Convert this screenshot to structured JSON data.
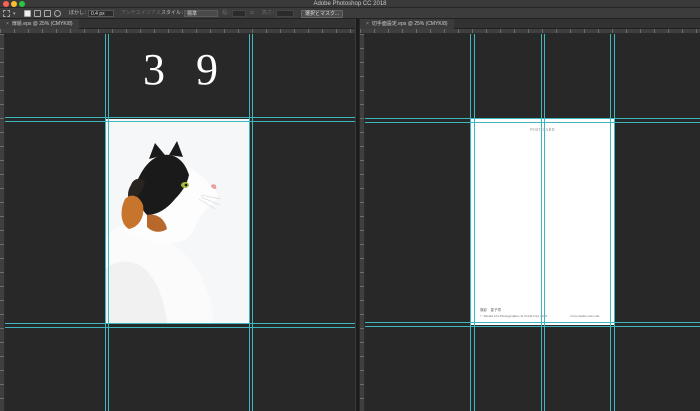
{
  "app": {
    "title": "Adobe Photoshop CC 2018"
  },
  "options_bar": {
    "feather_label": "ぼかし：",
    "feather_value": "0.4 px",
    "antialias_label": "アンチエイリアス",
    "style_label": "スタイル：",
    "style_value": "標準",
    "width_label": "幅：",
    "height_label": "高さ：",
    "mask_button": "選択とマスク..."
  },
  "documents": [
    {
      "tab_label": "扉絵.eps @ 25% (CMYK/8)",
      "page_number": "3 9"
    },
    {
      "tab_label": "切手面設定.eps @ 25% (CMYK/8)",
      "postcard": {
        "title": "POST CARD",
        "credit_name": "撮影　星子寿",
        "copyright": "© Yutaka Ura Photographer, in North City 2018",
        "website": "www.studio-ura.com"
      }
    }
  ],
  "colors": {
    "guide": "#3fb7bf",
    "canvas": "#282828",
    "toolbar": "#3c3c3c"
  },
  "icons": [
    "marquee-tool-icon",
    "new-selection-icon",
    "add-selection-icon",
    "subtract-selection-icon",
    "intersect-selection-icon",
    "swap-dimensions-icon",
    "close-icon"
  ]
}
